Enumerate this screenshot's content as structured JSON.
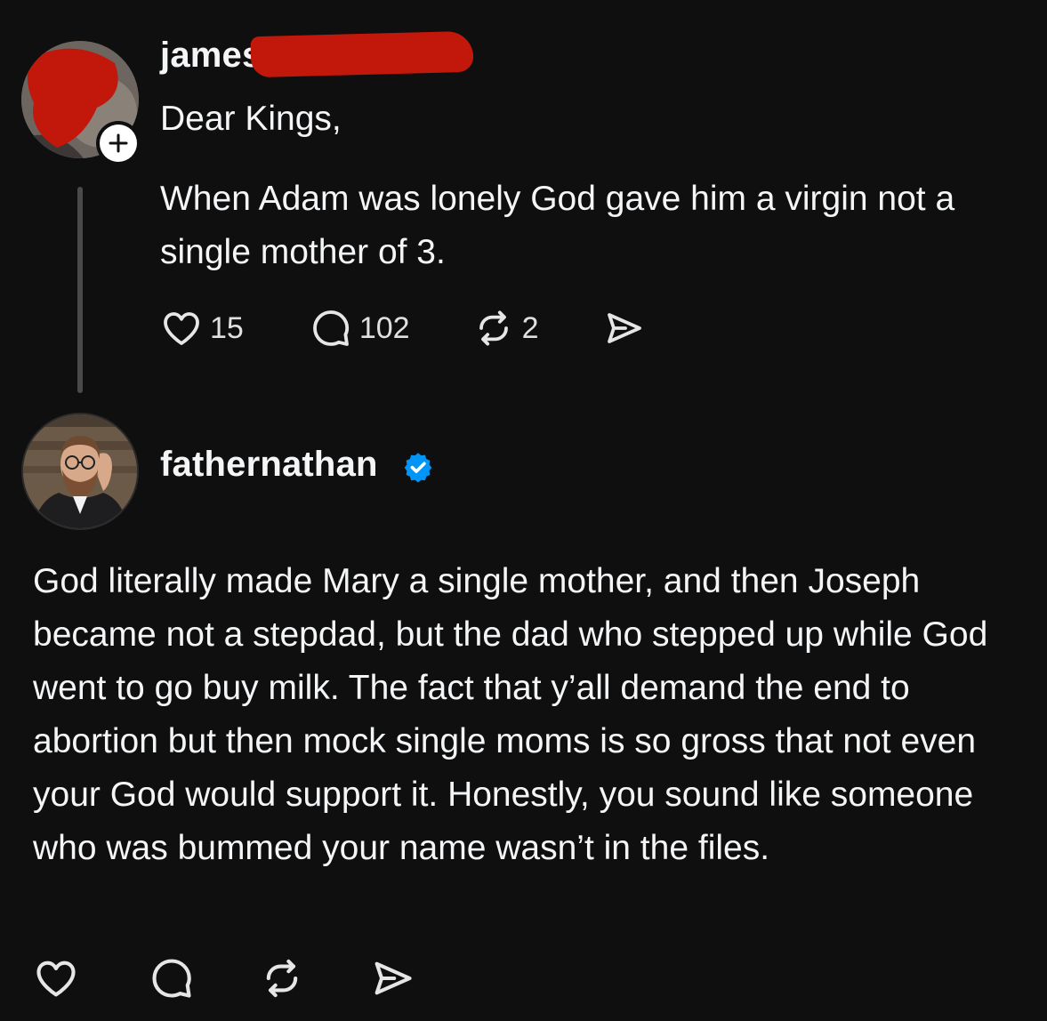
{
  "post_1": {
    "username": "james",
    "greeting": "Dear Kings,",
    "body": "When Adam was lonely God gave him a virgin not a single mother of 3.",
    "likes": "15",
    "replies": "102",
    "reposts": "2"
  },
  "post_2": {
    "username": "fathernathan",
    "verified": true,
    "body": "God literally made Mary a single mother, and then Joseph became not a stepdad, but the dad who stepped up while God went to go buy milk. The fact that y’all demand the end to abortion but then mock single moms is so gross that not even your God would support it. Honestly, you sound like someone who was bummed your name wasn’t in the files."
  },
  "icons": {
    "like": "heart-icon",
    "reply": "speech-bubble-icon",
    "repost": "repost-icon",
    "share": "send-icon",
    "follow": "plus-icon",
    "verified": "verified-badge-icon"
  },
  "colors": {
    "background": "#0f0f0f",
    "text": "#f3f5f7",
    "verified": "#0095f6",
    "redaction": "#c1180b"
  }
}
